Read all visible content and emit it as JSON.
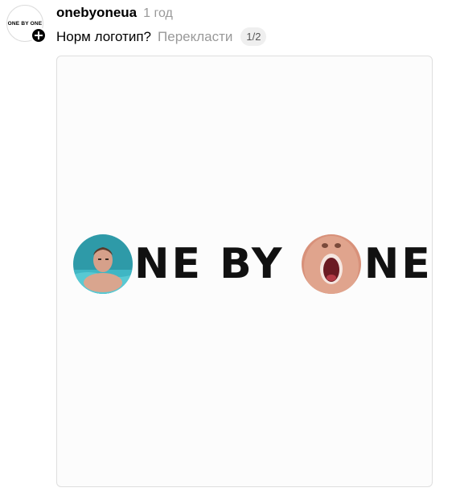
{
  "account": {
    "avatar_text": "ONE BY ONE",
    "username": "onebyoneua",
    "timestamp": "1 год"
  },
  "post": {
    "text": "Норм логотип?",
    "translate_label": "Перекласти",
    "pager": "1/2"
  },
  "media": {
    "logo_text_1": "NE BY ",
    "logo_text_2": "NE",
    "logo_photo_1": "man-in-pool-photo",
    "logo_photo_2": "open-mouth-face-photo"
  },
  "icons": {
    "follow": "plus-icon"
  },
  "colors": {
    "text": "#000000",
    "muted": "#999999",
    "pager_bg": "#efefef",
    "card_border": "#dedede",
    "logo_text": "#111111"
  }
}
